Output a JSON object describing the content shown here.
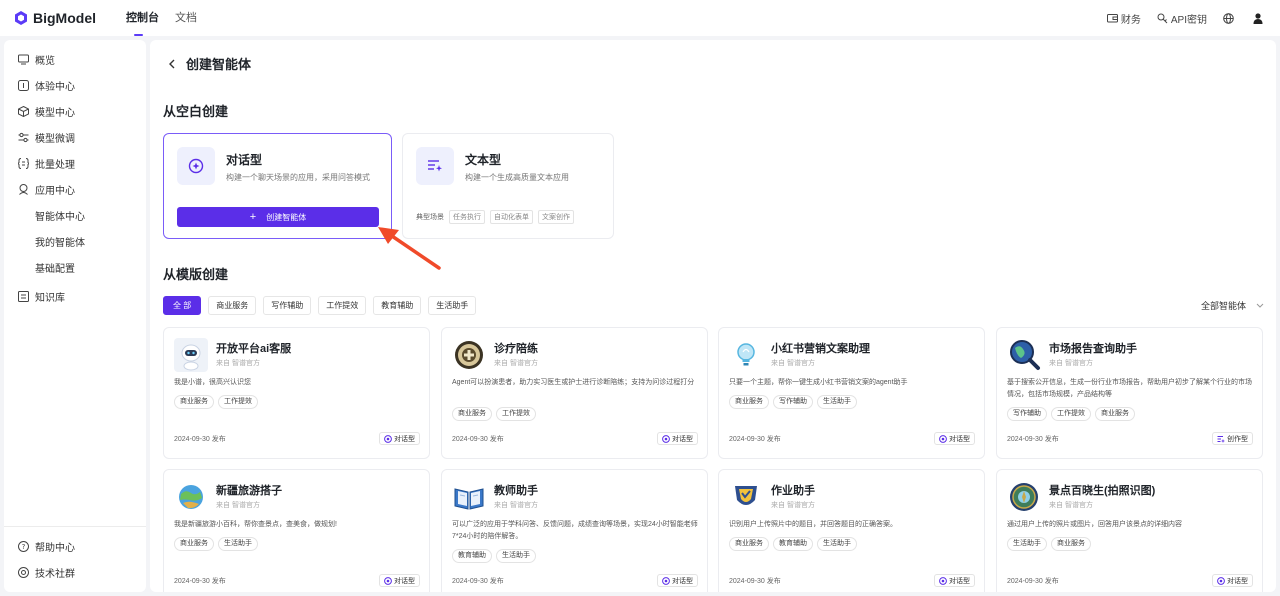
{
  "topbar": {
    "logo": "BigModel",
    "nav": [
      "控制台",
      "文档"
    ],
    "right": {
      "finance": "财务",
      "api_key": "API密钥"
    }
  },
  "sidebar": {
    "items": [
      {
        "label": "概览",
        "icon": "monitor-icon"
      },
      {
        "label": "体验中心",
        "icon": "chat-icon"
      },
      {
        "label": "模型中心",
        "icon": "cube-icon"
      },
      {
        "label": "模型微调",
        "icon": "sliders-icon"
      },
      {
        "label": "批量处理",
        "icon": "brackets-icon"
      },
      {
        "label": "应用中心",
        "icon": "robot-icon"
      },
      {
        "label": "智能体中心",
        "icon": ""
      },
      {
        "label": "我的智能体",
        "icon": ""
      },
      {
        "label": "基础配置",
        "icon": ""
      },
      {
        "label": "知识库",
        "icon": "book-icon"
      }
    ],
    "bottom": [
      {
        "label": "帮助中心",
        "icon": "help-icon"
      },
      {
        "label": "技术社群",
        "icon": "community-icon"
      }
    ]
  },
  "page": {
    "title": "创建智能体",
    "blank_section_title": "从空白创建",
    "template_section_title": "从模版创建"
  },
  "blank_cards": [
    {
      "title": "对话型",
      "desc": "构建一个聊天场景的应用，采用问答模式",
      "button": "创建智能体"
    },
    {
      "title": "文本型",
      "desc": "构建一个生成高质量文本应用",
      "typical_label": "典型场景",
      "chips": [
        "任务执行",
        "自动化表单",
        "文案创作"
      ]
    }
  ],
  "filters": {
    "tabs": [
      "全 部",
      "商业服务",
      "写作辅助",
      "工作提效",
      "教育辅助",
      "生活助手"
    ],
    "dropdown": "全部智能体"
  },
  "templates": [
    {
      "name": "开放平台ai客服",
      "source": "来自  智谱官方",
      "desc": "我是小谱，很高兴认识您",
      "tags": [
        "商业服务",
        "工作提效"
      ],
      "date": "2024-09-30 发布",
      "type": "对话型"
    },
    {
      "name": "诊疗陪练",
      "source": "来自  智谱官方",
      "desc": "Agent可以扮演患者，助力实习医生或护士进行诊断陪练；支持为问诊过程打分",
      "tags": [
        "商业服务",
        "工作提效"
      ],
      "date": "2024-09-30 发布",
      "type": "对话型"
    },
    {
      "name": "小红书营销文案助理",
      "source": "来自  智谱官方",
      "desc": "只要一个主题，帮你一键生成小红书营销文案的agent助手",
      "tags": [
        "商业服务",
        "写作辅助",
        "生活助手"
      ],
      "date": "2024-09-30 发布",
      "type": "对话型"
    },
    {
      "name": "市场报告查询助手",
      "source": "来自  智谱官方",
      "desc": "基于搜索公开信息，生成一份行业市场报告，帮助用户初步了解某个行业的市场情况，包括市场规模，产品结构等",
      "tags": [
        "写作辅助",
        "工作提效",
        "商业服务"
      ],
      "date": "2024-09-30 发布",
      "type": "创作型"
    },
    {
      "name": "新疆旅游搭子",
      "source": "来自  智谱官方",
      "desc": "我是新疆旅游小百科，帮你查景点，查美食，做规划!",
      "tags": [
        "商业服务",
        "生活助手"
      ],
      "date": "2024-09-30 发布",
      "type": "对话型"
    },
    {
      "name": "教师助手",
      "source": "来自  智谱官方",
      "desc": "可以广泛的应用于学科问答、反馈问题，成绩查询等场景，实现24小时智能老师 7*24小时的陪伴解答。",
      "tags": [
        "教育辅助",
        "生活助手"
      ],
      "date": "2024-09-30 发布",
      "type": "对话型"
    },
    {
      "name": "作业助手",
      "source": "来自  智谱官方",
      "desc": "识别用户上传照片中的题目，并回答题目的正确答案。",
      "tags": [
        "商业服务",
        "教育辅助",
        "生活助手"
      ],
      "date": "2024-09-30 发布",
      "type": "对话型"
    },
    {
      "name": "景点百晓生(拍照识图)",
      "source": "来自  智谱官方",
      "desc": "通过用户上传的照片或图片，回答用户该景点的详细内容",
      "tags": [
        "生活助手",
        "商业服务"
      ],
      "date": "2024-09-30 发布",
      "type": "对话型"
    }
  ],
  "colors": {
    "accent": "#5b2ee8",
    "arrow": "#f04a2a"
  }
}
